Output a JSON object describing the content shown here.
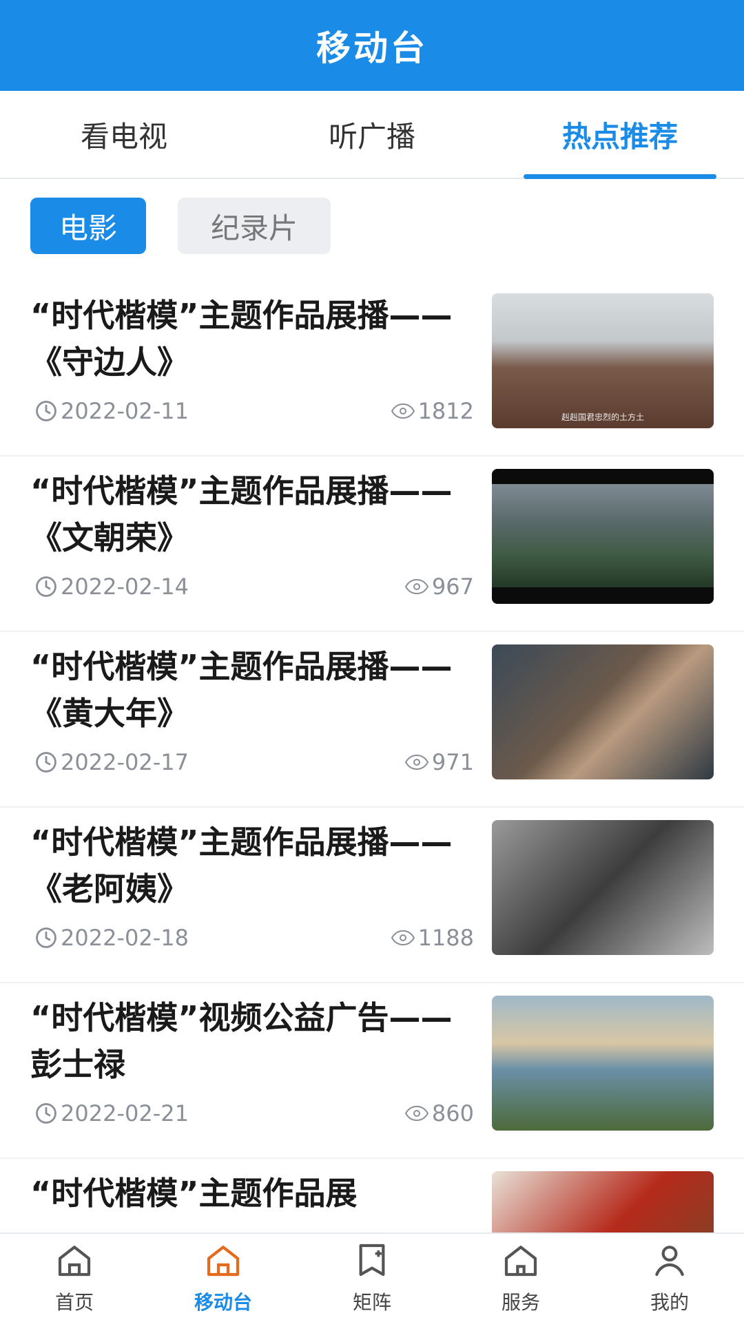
{
  "header": {
    "title": "移动台"
  },
  "tabs": [
    {
      "label": "看电视",
      "active": false
    },
    {
      "label": "听广播",
      "active": false
    },
    {
      "label": "热点推荐",
      "active": true
    }
  ],
  "chips": [
    {
      "label": "电影",
      "active": true
    },
    {
      "label": "纪录片",
      "active": false
    }
  ],
  "items": [
    {
      "title": "“时代楷模”主题作品展播——《守边人》",
      "date": "2022-02-11",
      "views": "1812",
      "caption": "赳赳国君忠烈的土方土"
    },
    {
      "title": "“时代楷模”主题作品展播——《文朝荣》",
      "date": "2022-02-14",
      "views": "967",
      "caption": ""
    },
    {
      "title": "“时代楷模”主题作品展播——《黄大年》",
      "date": "2022-02-17",
      "views": "971",
      "caption": ""
    },
    {
      "title": "“时代楷模”主题作品展播——《老阿姨》",
      "date": "2022-02-18",
      "views": "1188",
      "caption": ""
    },
    {
      "title": "“时代楷模”视频公益广告——彭士禄",
      "date": "2022-02-21",
      "views": "860",
      "caption": ""
    },
    {
      "title": "“时代楷模”主题作品展",
      "date": "",
      "views": "",
      "caption": ""
    }
  ],
  "bottom_nav": [
    {
      "label": "首页",
      "icon": "home-icon",
      "active": false
    },
    {
      "label": "移动台",
      "icon": "mobile-station-icon",
      "active": true
    },
    {
      "label": "矩阵",
      "icon": "matrix-icon",
      "active": false
    },
    {
      "label": "服务",
      "icon": "service-icon",
      "active": false
    },
    {
      "label": "我的",
      "icon": "user-icon",
      "active": false
    }
  ],
  "colors": {
    "primary": "#1a8be6",
    "text": "#1a1a1a",
    "meta": "#8a8f98"
  }
}
